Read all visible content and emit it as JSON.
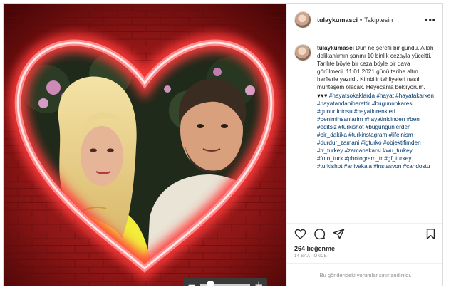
{
  "post": {
    "username": "tulaykumasci",
    "separator": "•",
    "follow_status": "Takiptesin",
    "more_glyph": "•••",
    "caption": "Dün ne şerefli bir gündü. Allah delikanlımın şanını 10 binlik cezayla yüceltti. Tarihte böyle bir ceza böyle bir dava görülmedi. 11.01.2021 günü tarihe altın harflerle yazıldı. Kimbilir tahliyeleri nasıl muhteşem olacak. Heyecanla bekliyorum. ♥♥♥",
    "hashtags": "#hayatsokaklarda #hayat #hayatakarken #hayatandanibarettir #bugununkaresi #gununfotosu #hayatinrenkleri #beniminsanlarim #hayatinicinden #ben #editsiz #turkishot #bugungunlerden #bir_dakika #turkinstagram #lifeinism #durdur_zamani #igturko #objektifimden #tr_turkey #zamanakarsi #wu_turkey #foto_turk #photogram_tr #gf_turkey #turkishot #anivakala #instasvon #candostu",
    "likes": "264 beğenme",
    "timestamp": "14 SAAT ÖNCE",
    "comments_disabled": "Bu gönderideki yorumlar sınırlandırıldı."
  },
  "viewer": {
    "zoom_out_glyph": "−",
    "zoom_in_glyph": "+",
    "zoom_level": 0.2
  },
  "icons": [
    "heart-icon",
    "comment-icon",
    "share-icon",
    "bookmark-icon",
    "more-icon"
  ],
  "colors": {
    "neon": "#ff5a5a",
    "link": "#00376b",
    "muted": "#8e8e8e",
    "wall": "#8b1414"
  }
}
